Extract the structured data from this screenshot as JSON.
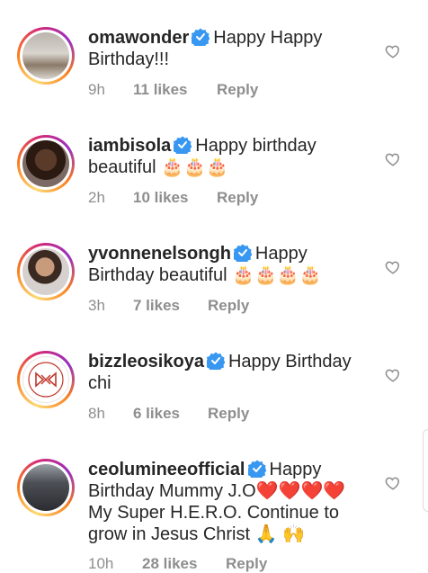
{
  "comments": [
    {
      "username": "omawonder",
      "text": "Happy Happy Birthday!!!",
      "time": "9h",
      "likes": "11 likes",
      "reply": "Reply",
      "avatar": "avatar-photo"
    },
    {
      "username": "iambisola",
      "text": "Happy birthday beautiful 🎂🎂🎂",
      "time": "2h",
      "likes": "10 likes",
      "reply": "Reply",
      "avatar": "avatar-photo"
    },
    {
      "username": "yvonnenelsongh",
      "text": "Happy Birthday beautiful 🎂🎂🎂🎂",
      "time": "3h",
      "likes": "7 likes",
      "reply": "Reply",
      "avatar": "avatar-photo"
    },
    {
      "username": "bizzleosikoya",
      "text": "Happy Birthday chi",
      "time": "8h",
      "likes": "6 likes",
      "reply": "Reply",
      "avatar": "avatar-logo"
    },
    {
      "username": "ceolumineeofficial",
      "text": "Happy Birthday Mummy J.O❤️❤️❤️❤️ My Super H.E.R.O.  Continue to grow in Jesus Christ 🙏 🙌",
      "time": "10h",
      "likes": "28 likes",
      "reply": "Reply",
      "avatar": "avatar-photo"
    }
  ],
  "icons": {
    "verified": "verified-badge-icon",
    "like": "heart-outline-icon"
  },
  "colors": {
    "verified_blue": "#3897f0",
    "meta_gray": "#8e8e8e",
    "text": "#262626"
  }
}
